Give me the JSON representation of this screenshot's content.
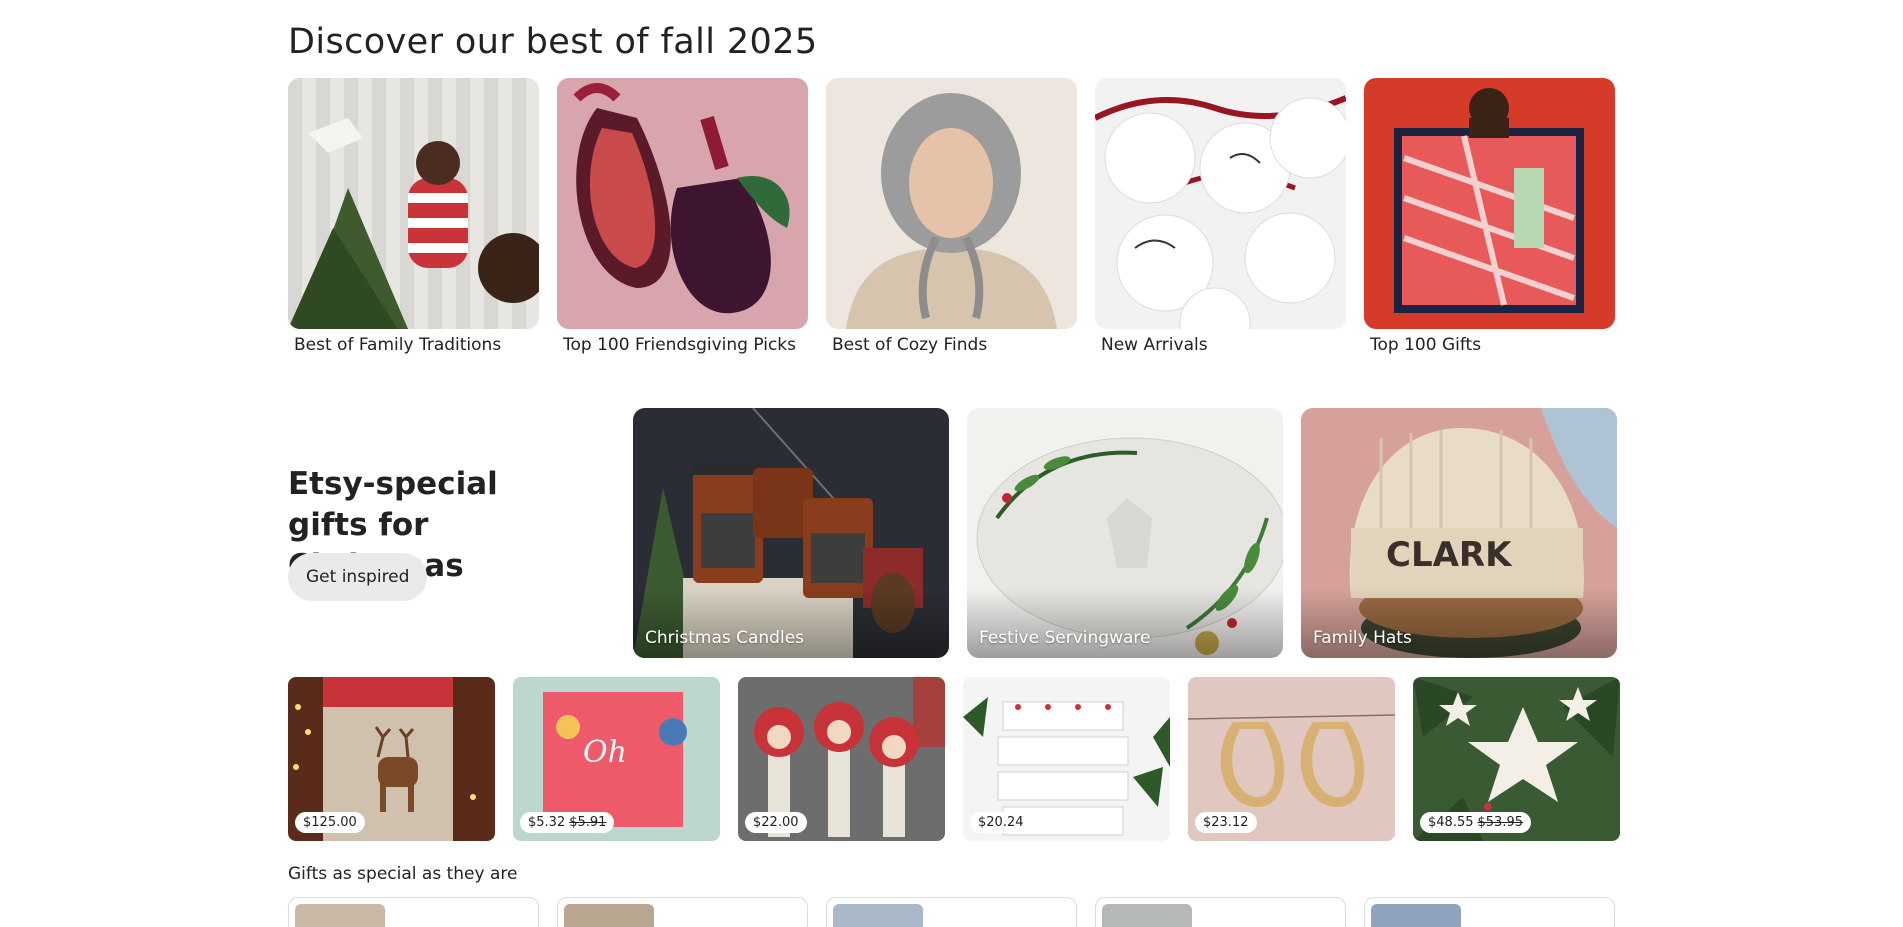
{
  "fall": {
    "title": "Discover our best of fall 2025",
    "cards": [
      {
        "label": "Best of Family Traditions",
        "image": "family-traditions-photo"
      },
      {
        "label": "Top 100 Friendsgiving Picks",
        "image": "fig-ornaments-photo"
      },
      {
        "label": "Best of Cozy Finds",
        "image": "knit-bonnet-photo"
      },
      {
        "label": "New Arrivals",
        "image": "illustrated-ornaments-photo"
      },
      {
        "label": "Top 100 Gifts",
        "image": "map-scarf-photo"
      }
    ]
  },
  "christmas": {
    "title": "Etsy-special gifts for Christmas",
    "button": "Get inspired",
    "categories": [
      {
        "label": "Christmas Candles"
      },
      {
        "label": "Festive Servingware"
      },
      {
        "label": "Family Hats"
      }
    ],
    "products": [
      {
        "price": "$125.00",
        "original": ""
      },
      {
        "price": "$5.32",
        "original": "$5.91"
      },
      {
        "price": "$22.00",
        "original": ""
      },
      {
        "price": "$20.24",
        "original": ""
      },
      {
        "price": "$23.12",
        "original": ""
      },
      {
        "price": "$48.55",
        "original": "$53.95"
      }
    ]
  },
  "gifts": {
    "heading": "Gifts as special as they are"
  },
  "colors": {
    "text": "#222222",
    "button_bg": "#eaeaea",
    "card_border": "#dcdcdc"
  }
}
